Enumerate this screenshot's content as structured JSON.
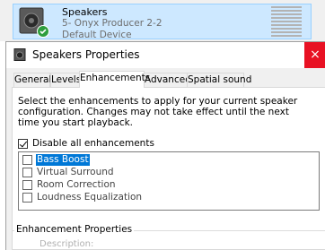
{
  "device": {
    "name": "Speakers",
    "model": "5- Onyx Producer 2-2",
    "status": "Default Device"
  },
  "dialog": {
    "title": "Speakers Properties",
    "close_glyph": "×"
  },
  "tabs": [
    {
      "label": "General"
    },
    {
      "label": "Levels"
    },
    {
      "label": "Enhancements",
      "active": true
    },
    {
      "label": "Advanced"
    },
    {
      "label": "Spatial sound"
    }
  ],
  "enhancements": {
    "instructions": "Select the enhancements to apply for your current speaker configuration. Changes may not take effect until the next time you start playback.",
    "disable_all_label": "Disable all enhancements",
    "disable_all_checked": true,
    "items": [
      {
        "label": "Bass Boost",
        "checked": false,
        "selected": true
      },
      {
        "label": "Virtual Surround",
        "checked": false,
        "selected": false
      },
      {
        "label": "Room Correction",
        "checked": false,
        "selected": false
      },
      {
        "label": "Loudness Equalization",
        "checked": false,
        "selected": false
      }
    ],
    "properties_title": "Enhancement Properties",
    "properties_description": "Description:"
  },
  "colors": {
    "selection": "#0078d7",
    "close_button": "#e81123",
    "device_highlight": "#cde8ff"
  }
}
